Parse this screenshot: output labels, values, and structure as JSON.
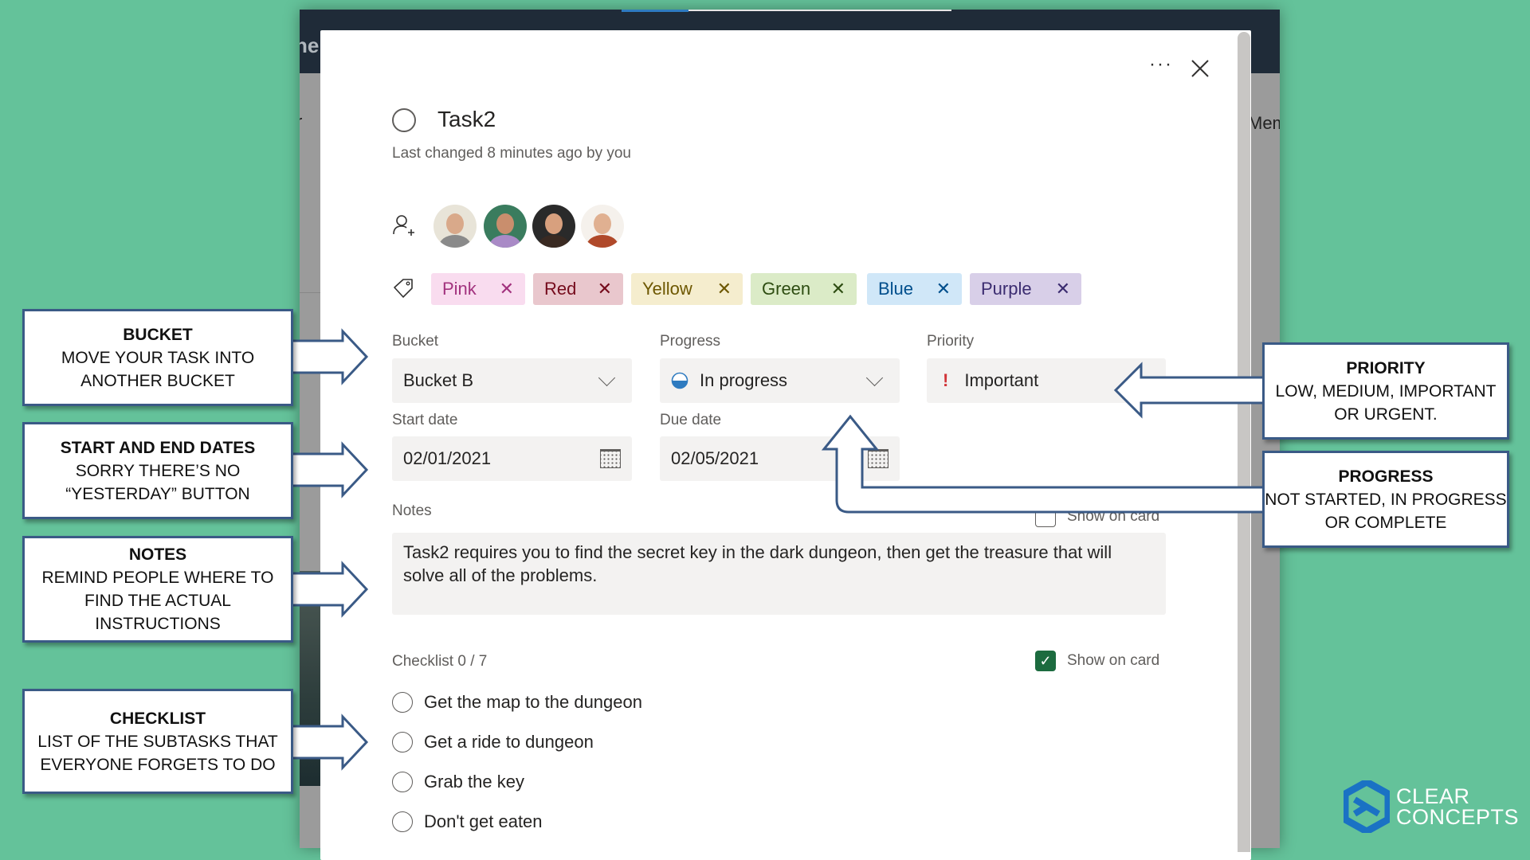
{
  "background_app": {
    "header_fragment_left": "ner",
    "toolbar_fragment_left": "r",
    "toolbar_fragment_right": "Mem"
  },
  "task": {
    "title": "Task2",
    "last_changed": "Last changed 8 minutes ago by you",
    "completed": false
  },
  "toolbar": {
    "more_label": "···",
    "close_label": "close"
  },
  "assignees": [
    {
      "name": "assignee-1",
      "skin": "#d9a98a",
      "shirt": "#8a8a8a",
      "bg": "#e8e4d8"
    },
    {
      "name": "assignee-2",
      "skin": "#c98e6d",
      "shirt": "#a98ac6",
      "bg": "#3a7c5e"
    },
    {
      "name": "assignee-3",
      "skin": "#d8a07e",
      "shirt": "#3a2a22",
      "bg": "#2a2a2a"
    },
    {
      "name": "assignee-4",
      "skin": "#e0b091",
      "shirt": "#b0492a",
      "bg": "#f5f1ec"
    }
  ],
  "labels": [
    {
      "text": "Pink",
      "bg": "#f9dcef",
      "fg": "#a2327e"
    },
    {
      "text": "Red",
      "bg": "#e9c7cd",
      "fg": "#750b1c"
    },
    {
      "text": "Yellow",
      "bg": "#f5edce",
      "fg": "#6d5700"
    },
    {
      "text": "Green",
      "bg": "#dbebc7",
      "fg": "#2e4d12"
    },
    {
      "text": "Blue",
      "bg": "#d0e7f8",
      "fg": "#004e8c"
    },
    {
      "text": "Purple",
      "bg": "#d8cfe8",
      "fg": "#3b2c70"
    }
  ],
  "fields": {
    "bucket_label": "Bucket",
    "bucket_value": "Bucket B",
    "progress_label": "Progress",
    "progress_value": "In progress",
    "priority_label": "Priority",
    "priority_value": "Important",
    "priority_icon": "!",
    "start_label": "Start date",
    "start_value": "02/01/2021",
    "due_label": "Due date",
    "due_value": "02/05/2021"
  },
  "notes": {
    "label": "Notes",
    "show_on_card_label": "Show on card",
    "show_on_card_checked": false,
    "text": "Task2 requires you to find the secret key in the dark dungeon, then get the treasure that will solve all of the problems."
  },
  "checklist": {
    "label": "Checklist 0 / 7",
    "show_on_card_label": "Show on card",
    "show_on_card_checked": true,
    "items": [
      {
        "text": "Get the map to the dungeon",
        "done": false
      },
      {
        "text": "Get a ride to dungeon",
        "done": false
      },
      {
        "text": "Grab the key",
        "done": false
      },
      {
        "text": "Don't get eaten",
        "done": false
      }
    ]
  },
  "callouts": {
    "bucket": {
      "title": "BUCKET",
      "lines": [
        "MOVE YOUR TASK INTO",
        "ANOTHER BUCKET"
      ]
    },
    "dates": {
      "title": "START AND END DATES",
      "lines": [
        "SORRY THERE’S NO",
        "“YESTERDAY” BUTTON"
      ]
    },
    "notes": {
      "title": "NOTES",
      "lines": [
        "REMIND PEOPLE WHERE TO",
        "FIND THE ACTUAL",
        "INSTRUCTIONS"
      ]
    },
    "checklist": {
      "title": "CHECKLIST",
      "lines": [
        "LIST OF THE SUBTASKS THAT",
        "EVERYONE FORGETS TO DO"
      ]
    },
    "priority": {
      "title": "PRIORITY",
      "lines": [
        "LOW, MEDIUM, IMPORTANT",
        "OR URGENT."
      ]
    },
    "progress": {
      "title": "PROGRESS",
      "lines": [
        "NOT STARTED, IN PROGRESS",
        "OR COMPLETE"
      ]
    }
  },
  "branding": {
    "logo_line1": "CLEAR",
    "logo_line2": "CONCEPTS",
    "logo_color": "#1a72c4"
  },
  "colors": {
    "slide_bg": "#64c29a",
    "callout_border": "#3a5a86",
    "checkbox_green": "#1c6b3f",
    "priority_red": "#d13438",
    "progress_blue": "#2e7bc0"
  }
}
